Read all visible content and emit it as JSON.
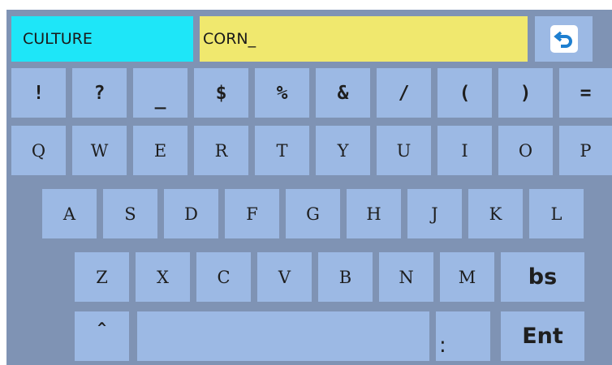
{
  "input": {
    "field_label": "CULTURE",
    "value": "CORN_"
  },
  "back_icon": "undo-arrow-icon",
  "colors": {
    "background": "#7f93b4",
    "key": "#9cb9e4",
    "label_field": "#1ee6f8",
    "value_field": "#f0e86e",
    "back_arrow": "#1e7fd0"
  },
  "keyboard": {
    "row1": [
      "!",
      "?",
      "_",
      "$",
      "%",
      "&",
      "/",
      "(",
      ")",
      "="
    ],
    "row2": [
      "Q",
      "W",
      "E",
      "R",
      "T",
      "Y",
      "U",
      "I",
      "O",
      "P"
    ],
    "row3": [
      "A",
      "S",
      "D",
      "F",
      "G",
      "H",
      "J",
      "K",
      "L"
    ],
    "row4": [
      "Z",
      "X",
      "C",
      "V",
      "B",
      "N",
      "M",
      "bs"
    ],
    "row5": {
      "shift": "^",
      "space": "",
      "colon": ":",
      "enter": "Ent"
    }
  }
}
